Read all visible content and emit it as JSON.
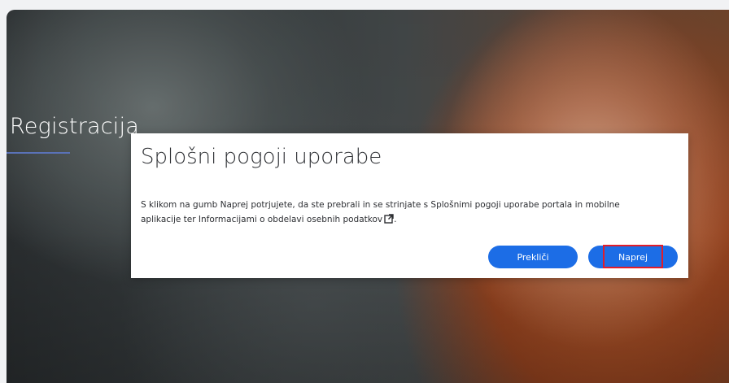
{
  "hero": {
    "title": "Registracija"
  },
  "modal": {
    "title": "Splošni pogoji uporabe",
    "body_line1": "S klikom na gumb Naprej potrjujete, da ste prebrali in se strinjate s Splošnimi pogoji uporabe portala in mobilne",
    "body_line2": "aplikacije ter Informacijami o obdelavi osebnih podatkov",
    "body_end": ".",
    "external_link_icon": "external-link-icon",
    "cancel_label": "Prekliči",
    "next_label": "Naprej"
  },
  "colors": {
    "button": "#1c6de6",
    "focus_outline": "#e11d2a",
    "underline": "#5a72b8"
  }
}
